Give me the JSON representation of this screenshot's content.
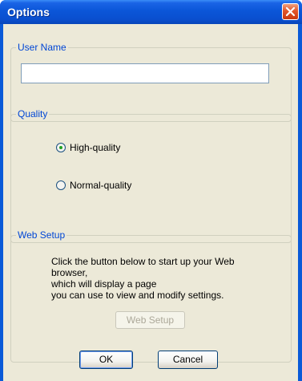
{
  "window": {
    "title": "Options"
  },
  "user_name": {
    "group_label": "User Name",
    "value": "",
    "placeholder": ""
  },
  "quality": {
    "group_label": "Quality",
    "options": [
      {
        "label": "High-quality",
        "selected": true
      },
      {
        "label": "Normal-quality",
        "selected": false
      }
    ]
  },
  "web_setup": {
    "group_label": "Web Setup",
    "description_lines": [
      "Click the button below to start up your Web",
      "browser,",
      "which will display a page",
      "you can use to view and modify settings."
    ],
    "button_label": "Web Setup",
    "button_enabled": false
  },
  "footer": {
    "ok_label": "OK",
    "cancel_label": "Cancel"
  },
  "colors": {
    "title_bar": "#0a5ad8",
    "group_label": "#0046d5",
    "dialog_bg": "#ece9d8",
    "close_button": "#e2552a"
  },
  "icons": {
    "close": "close-icon"
  }
}
